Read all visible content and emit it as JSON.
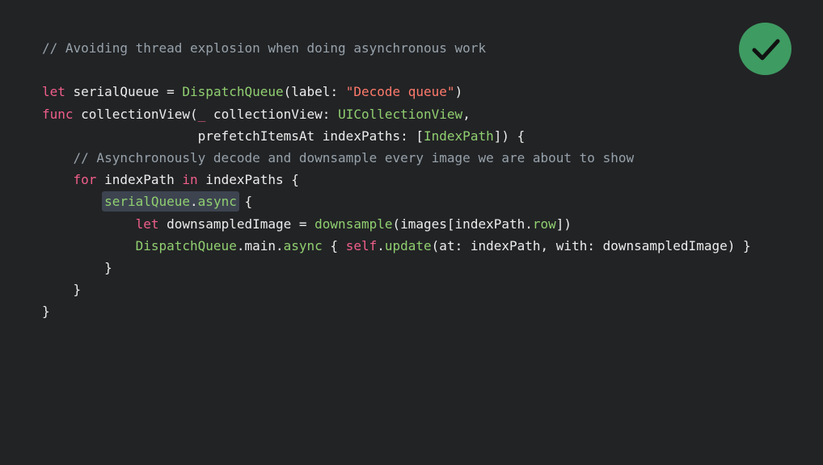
{
  "badge": {
    "icon": "checkmark-icon",
    "color": "#3e9b62"
  },
  "code": {
    "line1": {
      "comment": "// Avoiding thread explosion when doing asynchronous work"
    },
    "line3": {
      "kw_let": "let",
      "var": " serialQueue = ",
      "type": "DispatchQueue",
      "open": "(label: ",
      "string": "\"Decode queue\"",
      "close": ")"
    },
    "line4": {
      "kw_func": "func",
      "name": " collectionView(",
      "underscore": "_",
      "param": " collectionView: ",
      "type": "UICollectionView",
      "comma": ","
    },
    "line5": {
      "indent": "                    ",
      "param": "prefetchItemsAt indexPaths: [",
      "type": "IndexPath",
      "close": "]) {"
    },
    "line6": {
      "indent": "    ",
      "comment": "// Asynchronously decode and downsample every image we are about to show"
    },
    "line7": {
      "indent": "    ",
      "kw_for": "for",
      "var": " indexPath ",
      "kw_in": "in",
      "rest": " indexPaths {"
    },
    "line8": {
      "indent": "        ",
      "queue": "serialQueue",
      "dot": ".",
      "method": "async",
      "brace": " {"
    },
    "line9": {
      "indent": "            ",
      "kw_let": "let",
      "var": " downsampledImage = ",
      "fn": "downsample",
      "args": "(images[indexPath.",
      "prop": "row",
      "close": "])"
    },
    "line10": {
      "indent": "            ",
      "type": "DispatchQueue",
      "main": ".main.",
      "method": "async",
      "brace": " { ",
      "kw_self": "self",
      "dot": ".",
      "fn": "update",
      "args": "(at: indexPath, with: downsampledImage) }"
    },
    "line11": {
      "text": "        }"
    },
    "line12": {
      "text": "    }"
    },
    "line13": {
      "text": "}"
    }
  }
}
